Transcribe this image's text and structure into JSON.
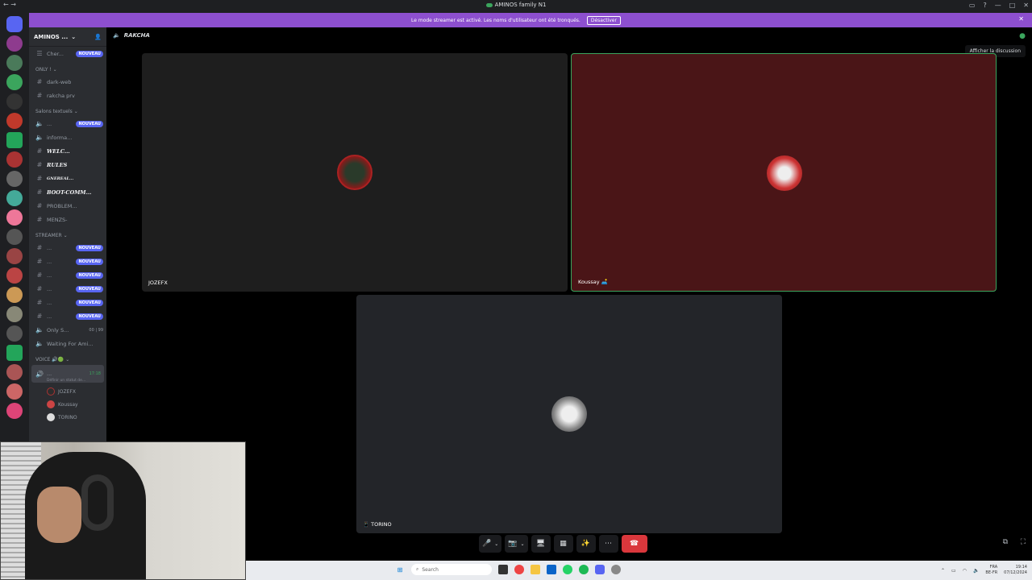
{
  "window": {
    "title": "AMINOS family N1",
    "controls": [
      "▭",
      "?",
      "—",
      "□",
      "✕"
    ]
  },
  "banner": {
    "message": "Le mode streamer est activé. Les noms d'utilisateur ont été tronqués.",
    "button": "Désactiver"
  },
  "sidebar": {
    "server_name": "AMINOS ...",
    "search": "Cher...",
    "new_badge": "NOUVEAU",
    "categories": {
      "only": "ONLY ! ⌄",
      "salons": "Salons textuels ⌄",
      "streamer": "STREAMER ⌄",
      "voice": "VOICE 🔊🟢 ⌄"
    },
    "only_channels": [
      "dark-web",
      "rakcha prv"
    ],
    "text_channels": [
      {
        "name": "...",
        "badge": true
      },
      {
        "name": "informa...",
        "badge": false
      },
      {
        "name": "WELC...",
        "badge": false
      },
      {
        "name": "RULES",
        "badge": false
      },
      {
        "name": "GNEREAL...",
        "badge": false
      },
      {
        "name": "BOOT-COMM...",
        "badge": false
      },
      {
        "name": "PROBLEM...",
        "badge": false
      },
      {
        "name": "MENZS-",
        "badge": false
      }
    ],
    "streamer_channels": [
      "...",
      "...",
      "...",
      "...",
      "...",
      "..."
    ],
    "voice_extra": [
      {
        "name": "Only S...",
        "count": "00 | 99"
      },
      {
        "name": "Waiting For Ami...",
        "count": ""
      }
    ],
    "active_voice": {
      "name": "...",
      "time": "17:18",
      "status": "Définir un statut de..."
    },
    "members": [
      "JOZEFX",
      "Koussay",
      "TORINO"
    ]
  },
  "call": {
    "channel": "RAKCHA",
    "tiles": [
      {
        "name": "JOZEFX"
      },
      {
        "name": "Koussay 🛋️"
      },
      {
        "name": "📱 TORINO"
      }
    ],
    "tooltip": "Afficher la discussion"
  },
  "controls": [
    "🎤",
    "⌄",
    "📷",
    "⌄",
    "🖥",
    "▦",
    "✨",
    "⋯",
    "☎"
  ],
  "taskbar": {
    "search": "Search",
    "lang": "FRA",
    "region": "BE-FR",
    "time": "19:14",
    "date": "07/12/2024"
  }
}
